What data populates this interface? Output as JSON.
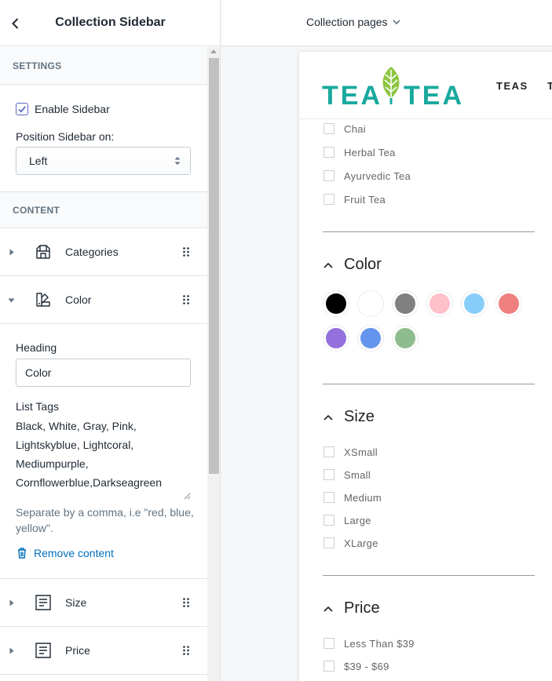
{
  "sidebar": {
    "title": "Collection Sidebar",
    "back_icon": "chevron-left-icon",
    "settings": {
      "heading": "SETTINGS",
      "enable_sidebar_label": "Enable Sidebar",
      "enable_sidebar_checked": true,
      "position_label": "Position Sidebar on:",
      "position_value": "Left"
    },
    "content": {
      "heading": "CONTENT",
      "blocks": [
        {
          "label": "Categories",
          "icon": "collection-icon",
          "expanded": false
        },
        {
          "label": "Color",
          "icon": "color-palette-icon",
          "expanded": true
        },
        {
          "label": "Size",
          "icon": "text-block-icon",
          "expanded": false
        },
        {
          "label": "Price",
          "icon": "text-block-icon",
          "expanded": false
        }
      ],
      "color_block": {
        "heading_label": "Heading",
        "heading_value": "Color",
        "list_tags_label": "List Tags",
        "list_tags_lines": [
          "Black, White, Gray, Pink,",
          "Lightskyblue, Lightcoral,",
          "Mediumpurple,",
          "Cornflowerblue,Darkseagreen"
        ],
        "help_text": "Separate by a comma, i.e \"red, blue, yellow\".",
        "remove_label": "Remove content"
      }
    }
  },
  "topbar": {
    "page_selector": "Collection pages"
  },
  "preview": {
    "logo_left": "TEA",
    "logo_right": "TEA",
    "nav_items": [
      "TEAS",
      "T"
    ],
    "categories": [
      "Chai",
      "Herbal Tea",
      "Ayurvedic Tea",
      "Fruit Tea"
    ],
    "color_heading": "Color",
    "swatches": [
      "#000000",
      "#ffffff",
      "#808080",
      "#ffc0cb",
      "#87cefa",
      "#f08080",
      "#9370db",
      "#6495ed",
      "#8fbc8f"
    ],
    "size_heading": "Size",
    "sizes": [
      "XSmall",
      "Small",
      "Medium",
      "Large",
      "XLarge"
    ],
    "price_heading": "Price",
    "prices": [
      "Less Than $39",
      "$39 - $69"
    ]
  },
  "colors": {
    "brand_teal": "#1aa99e",
    "leaf_green": "#8cc63f",
    "link_blue": "#006fbb",
    "checkbox_accent": "#5c6ac4"
  }
}
